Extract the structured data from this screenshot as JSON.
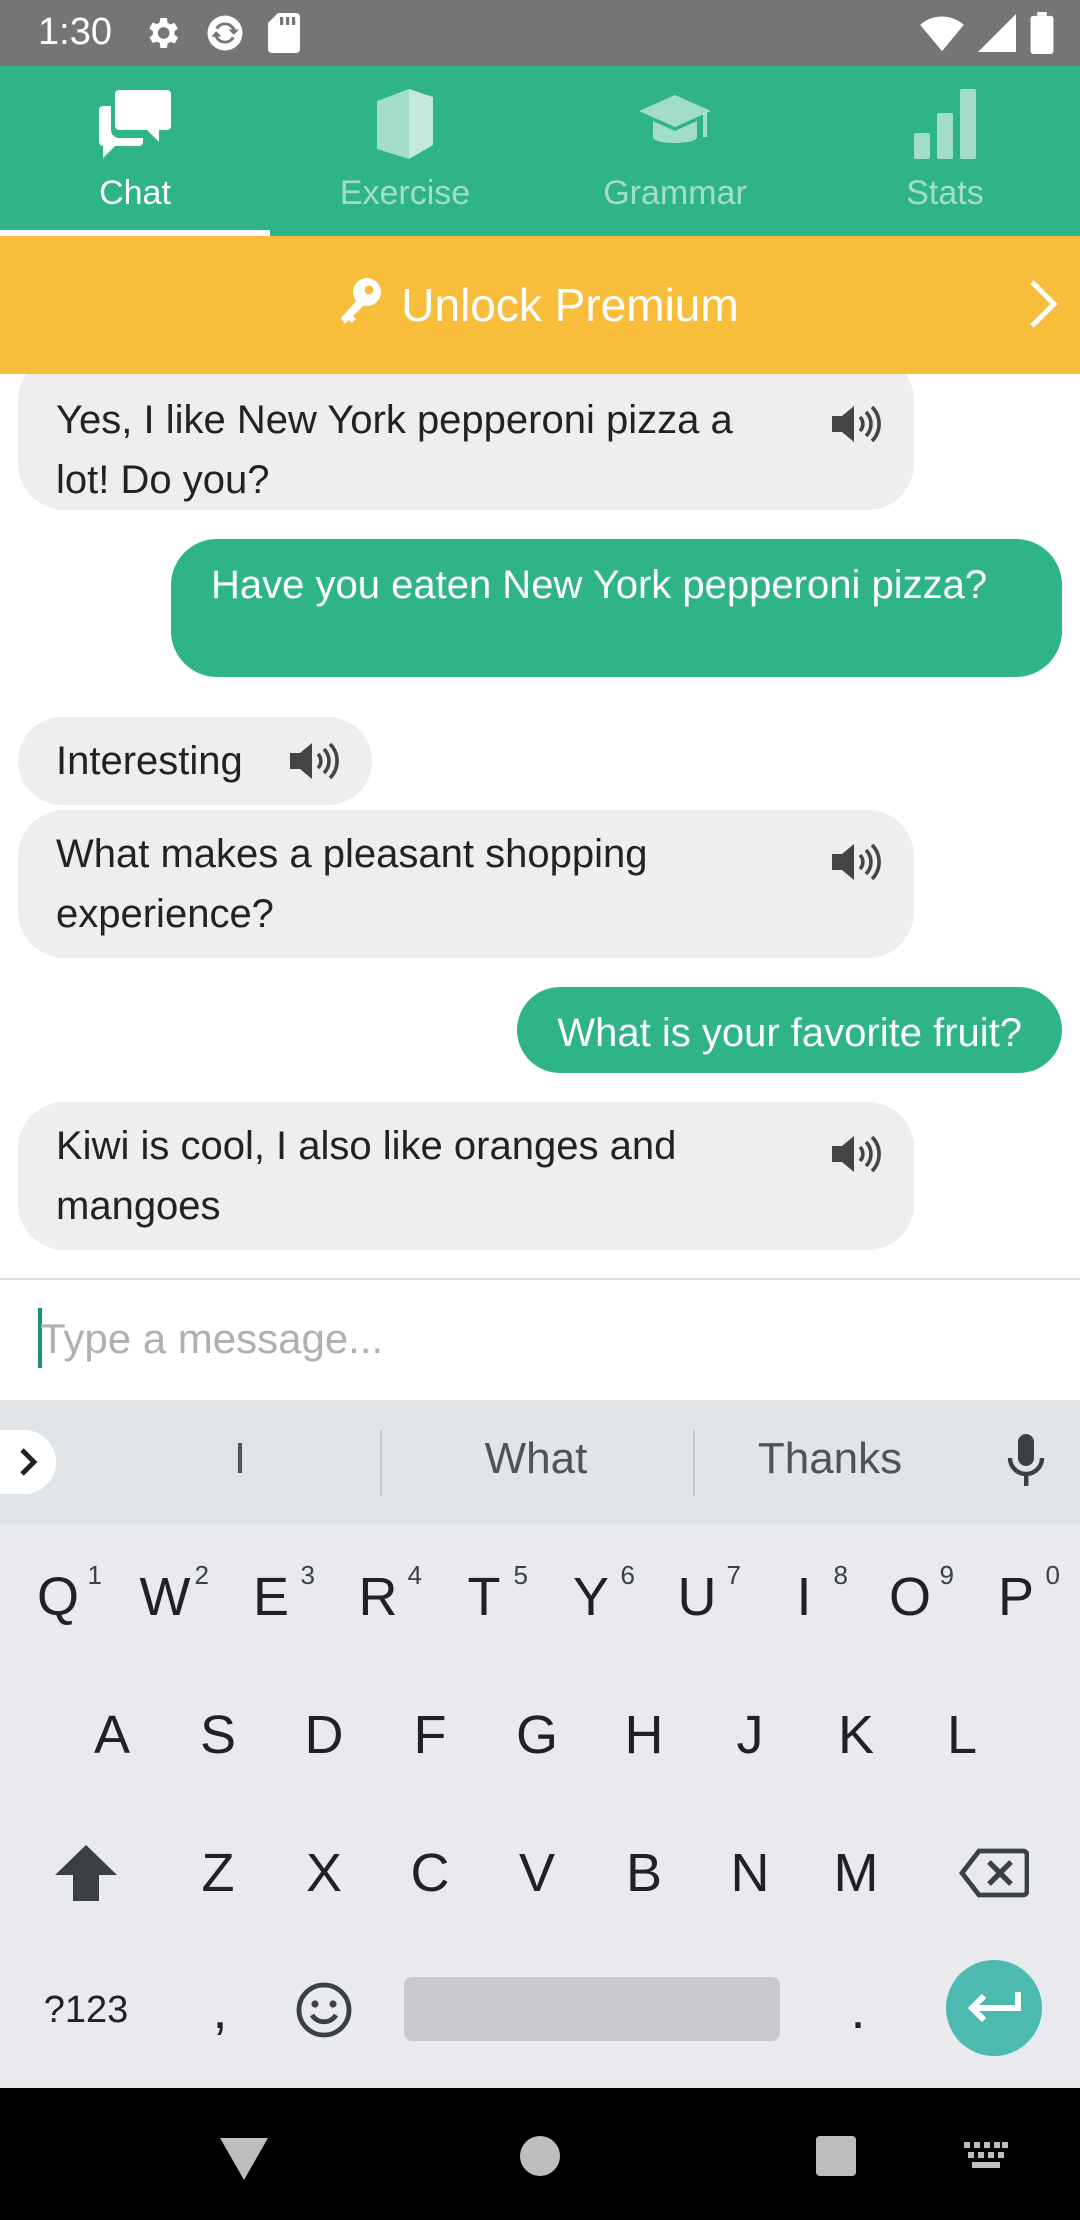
{
  "status_bar": {
    "time": "1:30",
    "left_icons": [
      "gear-icon",
      "sync-icon",
      "sd-card-icon"
    ],
    "right_icons": [
      "wifi-icon",
      "signal-icon",
      "battery-icon"
    ]
  },
  "tabs": [
    {
      "label": "Chat",
      "icon": "chat-bubbles-icon",
      "active": true
    },
    {
      "label": "Exercise",
      "icon": "book-icon",
      "active": false
    },
    {
      "label": "Grammar",
      "icon": "graduation-cap-icon",
      "active": false
    },
    {
      "label": "Stats",
      "icon": "bar-chart-icon",
      "active": false
    }
  ],
  "premium": {
    "label": "Unlock Premium",
    "icon": "key-icon"
  },
  "messages": [
    {
      "from": "bot",
      "text_lines": [
        "Yes, I like New York pepperoni pizza a",
        "lot! Do you?"
      ],
      "speaker": true
    },
    {
      "from": "user",
      "text": "Have you eaten New York pepperoni pizza?"
    },
    {
      "from": "bot",
      "text_lines": [
        "Interesting"
      ],
      "speaker": true
    },
    {
      "from": "bot",
      "text_lines": [
        "What makes a pleasant shopping",
        "experience?"
      ],
      "speaker": true
    },
    {
      "from": "user",
      "text": "What is your favorite fruit?"
    },
    {
      "from": "bot",
      "text_lines": [
        "Kiwi is cool, I also like oranges and",
        "mangoes"
      ],
      "speaker": true
    }
  ],
  "input": {
    "placeholder": "Type a message...",
    "value": ""
  },
  "keyboard": {
    "suggestions": [
      "I",
      "What",
      "Thanks"
    ],
    "row1": [
      "Q",
      "W",
      "E",
      "R",
      "T",
      "Y",
      "U",
      "I",
      "O",
      "P"
    ],
    "row1_hints": [
      "1",
      "2",
      "3",
      "4",
      "5",
      "6",
      "7",
      "8",
      "9",
      "0"
    ],
    "row2": [
      "A",
      "S",
      "D",
      "F",
      "G",
      "H",
      "J",
      "K",
      "L"
    ],
    "row3": [
      "Z",
      "X",
      "C",
      "V",
      "B",
      "N",
      "M"
    ],
    "symbols_key": "?123",
    "comma_key": ",",
    "period_key": "."
  },
  "colors": {
    "brand_green": "#2fb489",
    "premium_yellow": "#f8be3b",
    "enter_teal": "#4dbab0"
  }
}
